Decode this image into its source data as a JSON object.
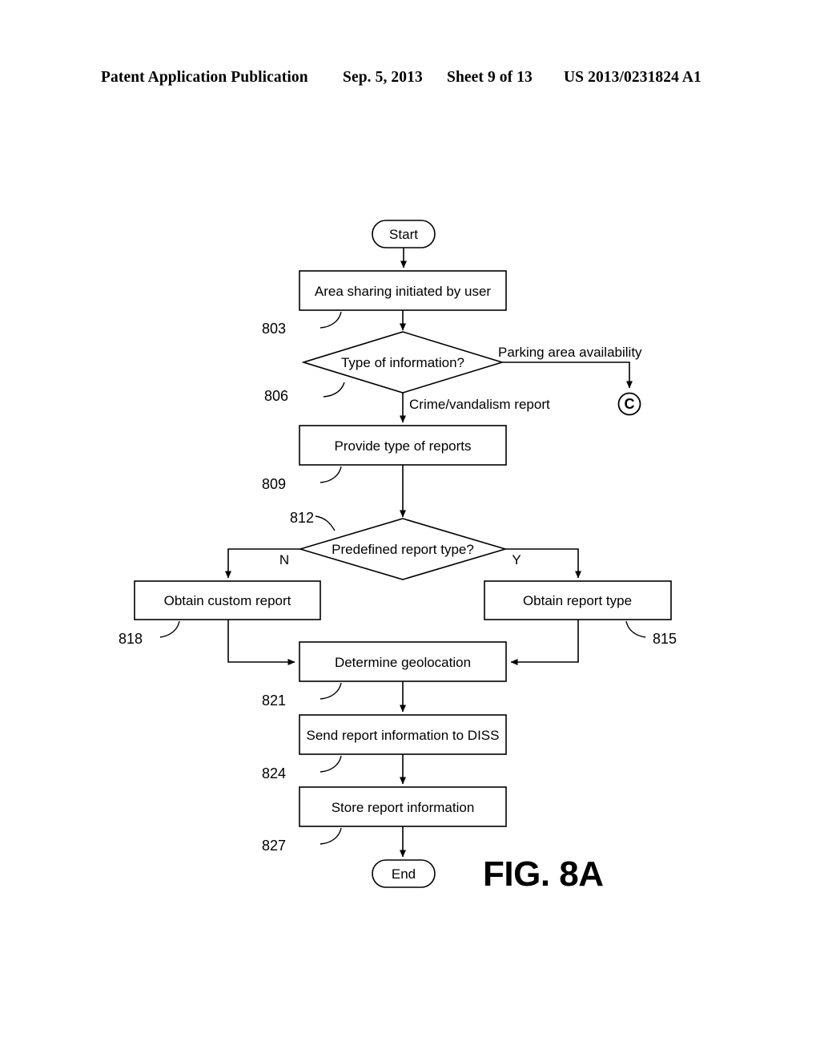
{
  "header": {
    "publication": "Patent Application Publication",
    "date": "Sep. 5, 2013",
    "sheet": "Sheet 9 of 13",
    "patent_number": "US 2013/0231824 A1"
  },
  "figure": {
    "caption": "FIG. 8A"
  },
  "flowchart": {
    "start_label": "Start",
    "end_label": "End",
    "connector_label": "C",
    "nodes": [
      {
        "id": "n803",
        "text": "Area sharing initiated by user",
        "ref": "803",
        "shape": "process"
      },
      {
        "id": "n806",
        "text": "Type of information?",
        "ref": "806",
        "shape": "decision"
      },
      {
        "id": "n809",
        "text": "Provide type of reports",
        "ref": "809",
        "shape": "process"
      },
      {
        "id": "n812",
        "text": "Predefined report type?",
        "ref": "812",
        "shape": "decision"
      },
      {
        "id": "n818",
        "text": "Obtain custom report",
        "ref": "818",
        "shape": "process"
      },
      {
        "id": "n815",
        "text": "Obtain report type",
        "ref": "815",
        "shape": "process"
      },
      {
        "id": "n821",
        "text": "Determine geolocation",
        "ref": "821",
        "shape": "process"
      },
      {
        "id": "n824",
        "text": "Send report information to DISS",
        "ref": "824",
        "shape": "process"
      },
      {
        "id": "n827",
        "text": "Store report information",
        "ref": "827",
        "shape": "process"
      }
    ],
    "edge_labels": {
      "parking": "Parking area availability",
      "crime": "Crime/vandalism report",
      "no": "N",
      "yes": "Y"
    }
  }
}
